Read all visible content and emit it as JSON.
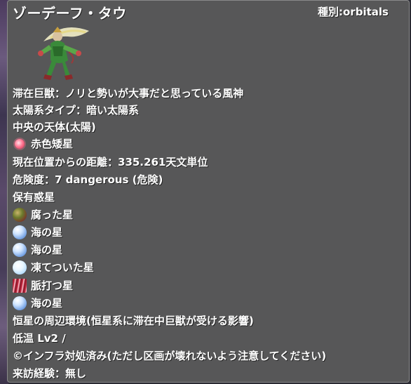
{
  "header": {
    "title": "ゾーデーフ・タウ",
    "type": "種別:orbitals"
  },
  "portrait": {
    "icon": "wind-god-portrait-icon"
  },
  "info": {
    "resident_beast": "滞在巨獣：ノリと勢いが大事だと思っている風神",
    "solar_type": "太陽系タイプ：暗い太陽系",
    "central_body_heading": "中央の天体(太陽)",
    "central_body": "赤色矮星",
    "distance": "現在位置からの距離：335.261天文単位",
    "danger": "危険度：7 dangerous (危険)",
    "planets_heading": "保有惑星",
    "planets": [
      {
        "name": "腐った星",
        "icon": "rotten-planet-icon"
      },
      {
        "name": "海の星",
        "icon": "sea-planet-icon"
      },
      {
        "name": "海の星",
        "icon": "sea-planet-icon"
      },
      {
        "name": "凍てついた星",
        "icon": "frozen-planet-icon"
      },
      {
        "name": "脈打つ星",
        "icon": "pulsing-planet-icon"
      },
      {
        "name": "海の星",
        "icon": "sea-planet-icon"
      }
    ],
    "environment_heading": "恒星の周辺環境(恒星系に滞在中巨獣が受ける影響)",
    "environment_value": "低温 Lv2 /",
    "infra": "©インフラ対処済み(ただし区画が壊れないよう注意してください)",
    "visit": "来訪経験：無し"
  }
}
